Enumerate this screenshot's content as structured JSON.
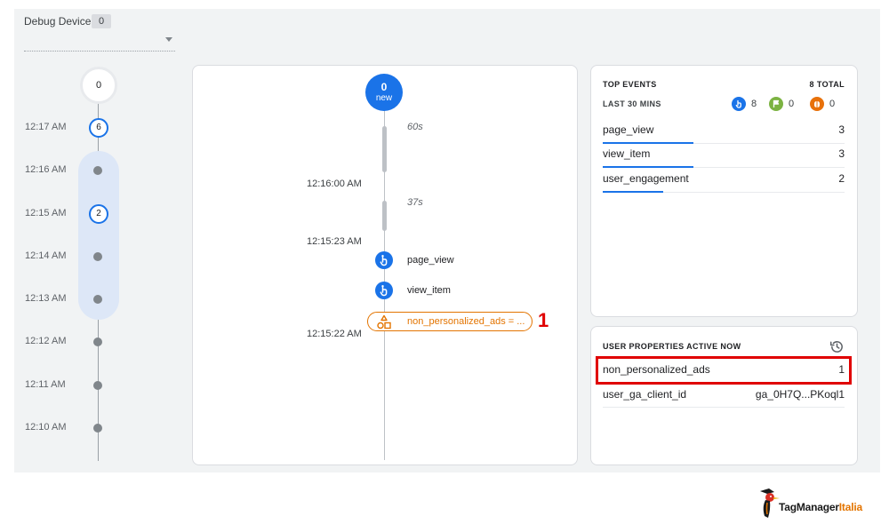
{
  "debug_device": {
    "label": "Debug Device",
    "count": "0"
  },
  "minutes": {
    "top_count": "0",
    "rows": [
      {
        "time": "12:17 AM",
        "badge": "6"
      },
      {
        "time": "12:16 AM",
        "badge": ""
      },
      {
        "time": "12:15 AM",
        "badge": "2"
      },
      {
        "time": "12:14 AM",
        "badge": ""
      },
      {
        "time": "12:13 AM",
        "badge": ""
      },
      {
        "time": "12:12 AM",
        "badge": ""
      },
      {
        "time": "12:11 AM",
        "badge": ""
      },
      {
        "time": "12:10 AM",
        "badge": ""
      }
    ]
  },
  "stream": {
    "new_count": "0",
    "new_label": "new",
    "gap_1": "60s",
    "time_1": "12:16:00 AM",
    "gap_2": "37s",
    "time_2": "12:15:23 AM",
    "events": [
      "page_view",
      "view_item"
    ],
    "user_property_event": "non_personalized_ads = ...",
    "time_3": "12:15:22 AM",
    "annotation": "1"
  },
  "top_events": {
    "title": "TOP EVENTS",
    "total": "8 TOTAL",
    "subtitle": "LAST 30 MINS",
    "stats": [
      {
        "icon": "event-icon",
        "value": "8",
        "color": "#1a73e8"
      },
      {
        "icon": "conversion-flag-icon",
        "value": "0",
        "color": "#7cb342"
      },
      {
        "icon": "error-icon",
        "value": "0",
        "color": "#e8710a"
      }
    ],
    "rows": [
      {
        "name": "page_view",
        "count": "3",
        "share": 0.375
      },
      {
        "name": "view_item",
        "count": "3",
        "share": 0.375
      },
      {
        "name": "user_engagement",
        "count": "2",
        "share": 0.25
      }
    ]
  },
  "user_properties": {
    "title": "USER PROPERTIES ACTIVE NOW",
    "history_icon": "history-icon",
    "rows": [
      {
        "name": "non_personalized_ads",
        "value": "1"
      },
      {
        "name": "user_ga_client_id",
        "value": "ga_0H7Q...PKoql1"
      }
    ]
  },
  "brand": {
    "name_main": "TagManager",
    "name_accent": "Italia",
    "accent_color": "#e37400"
  }
}
